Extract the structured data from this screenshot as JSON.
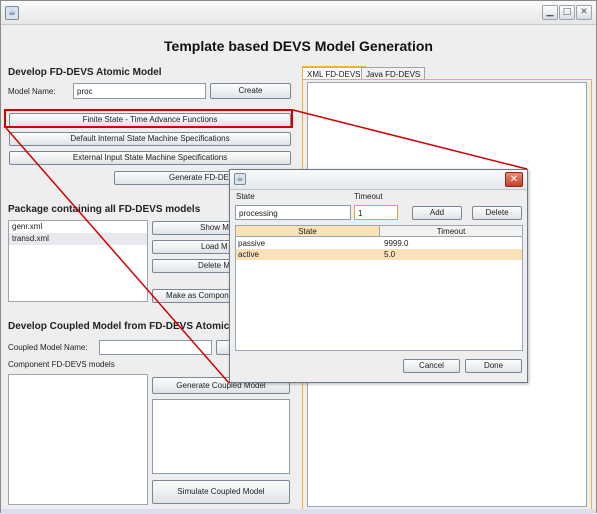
{
  "window": {
    "title": "",
    "heading": "Template based DEVS Model Generation",
    "controls": [
      "minimize",
      "maximize",
      "close"
    ]
  },
  "atomic": {
    "section_title": "Develop FD-DEVS Atomic Model",
    "model_name_label": "Model Name:",
    "model_name_value": "proc",
    "create_label": "Create",
    "fsm_btn": "Finite State - Time Advance Functions",
    "internal_btn": "Default Internal State Machine Specifications",
    "external_btn": "External Input State Machine Specifications",
    "generate_btn": "Generate FD-DEVS"
  },
  "package": {
    "section_title": "Package containing all FD-DEVS models",
    "files": [
      "genr.xml",
      "transd.xml"
    ],
    "show_btn": "Show M",
    "load_btn": "Load M",
    "delete_btn": "Delete M",
    "component_btn": "Make as Compone"
  },
  "coupled": {
    "section_title": "Develop Coupled Model from FD-DEVS Atomic M",
    "name_label": "Coupled Model Name:",
    "name_value": "",
    "components_label": "Component FD-DEVS models",
    "generate_btn": "Generate Coupled Model",
    "simulate_btn": "Simulate Coupled Model"
  },
  "tabs": [
    {
      "label": "XML FD-DEVS",
      "active": true
    },
    {
      "label": "Java FD-DEVS",
      "active": false
    }
  ],
  "dialog": {
    "state_label": "State",
    "timeout_label": "Timeout",
    "state_value": "processing",
    "timeout_value": "1",
    "add_btn": "Add",
    "delete_btn": "Delete",
    "columns": [
      "State",
      "Timeout"
    ],
    "rows": [
      {
        "state": "passive",
        "timeout": "9999.0",
        "selected": false
      },
      {
        "state": "active",
        "timeout": "5.0",
        "selected": true
      }
    ],
    "cancel_btn": "Cancel",
    "done_btn": "Done"
  },
  "colors": {
    "accent": "#f0b040",
    "highlight": "#d40000",
    "row_selected": "#fce0b8"
  }
}
